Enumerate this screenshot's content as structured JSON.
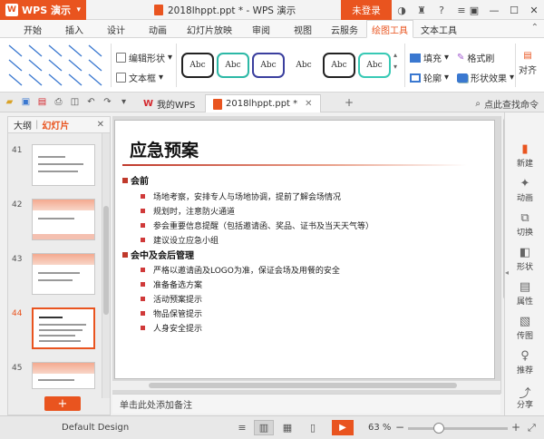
{
  "titlebar": {
    "app_label": "WPS 演示",
    "window_title": "2018lhppt.ppt * - WPS 演示",
    "login_label": "未登录"
  },
  "menu": {
    "tabs": [
      "开始",
      "插入",
      "设计",
      "动画",
      "幻灯片放映",
      "审阅",
      "视图",
      "云服务",
      "绘图工具",
      "文本工具"
    ],
    "active": "绘图工具"
  },
  "ribbon": {
    "edit_shape_label": "编辑形状",
    "textbox_label": "文本框",
    "style_preview_text": "Abc",
    "style_colors": [
      "#222222",
      "#2cb8a6",
      "#3b3f9e",
      "#ffffff",
      "#222222",
      "#38c9b5"
    ],
    "fill_label": "填充",
    "outline_label": "轮廓",
    "format_brush_label": "格式刷",
    "shape_effect_label": "形状效果",
    "align_label": "对齐"
  },
  "doc_tabs": {
    "tab1_label": "我的WPS",
    "tab2_label": "2018lhppt.ppt *",
    "command_search": "点此查找命令"
  },
  "left_panel": {
    "outline_label": "大纲",
    "slides_label": "幻灯片",
    "slide_numbers": [
      "41",
      "42",
      "43",
      "44",
      "45"
    ],
    "selected": "44"
  },
  "slide": {
    "title": "应急预案",
    "sections": [
      {
        "heading": "会前",
        "items": [
          "场地考察，安排专人与场地协调，提前了解会场情况",
          "规划时，注意防火通道",
          "参会重要信息提醒（包括邀请函、奖品、证书及当天天气等）",
          "建议设立应急小组"
        ]
      },
      {
        "heading": "会中及会后管理",
        "items": [
          "严格以邀请函及LOGO为准，保证会场及用餐的安全",
          "准备备选方案",
          "活动预案提示",
          "物品保管提示",
          "人身安全提示"
        ]
      }
    ]
  },
  "notes_placeholder": "单击此处添加备注",
  "right_panel": {
    "items": [
      "新建",
      "动画",
      "切换",
      "形状",
      "属性",
      "传图",
      "推荐",
      "分享"
    ]
  },
  "statusbar": {
    "design": "Default Design",
    "zoom": "63 %"
  },
  "accent_color": "#e9541f"
}
